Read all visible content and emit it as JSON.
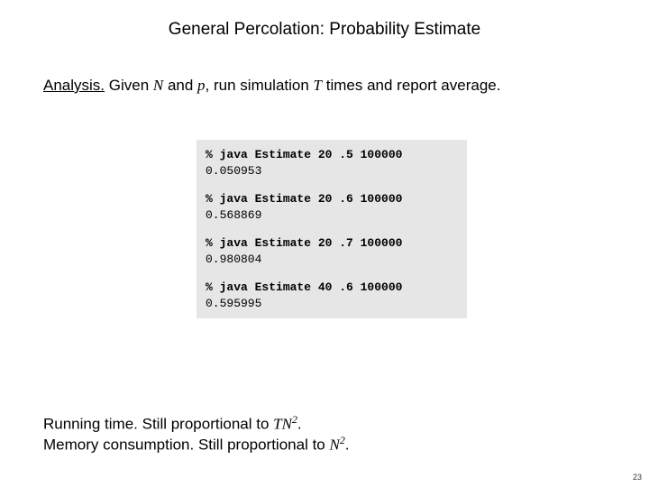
{
  "title": "General Percolation: Probability Estimate",
  "analysis": {
    "label": "Analysis.",
    "text_before_N": " Given ",
    "N": "N",
    "text_and": " and ",
    "p": "p",
    "text_mid": ", run simulation ",
    "T": "T",
    "text_after": " times and report average."
  },
  "code": {
    "entries": [
      {
        "cmd": "% java Estimate 20 .5 100000",
        "out": "0.050953"
      },
      {
        "cmd": "% java Estimate 20 .6 100000",
        "out": "0.568869"
      },
      {
        "cmd": "% java Estimate 20 .7 100000",
        "out": "0.980804"
      },
      {
        "cmd": "% java Estimate 40 .6 100000",
        "out": "0.595995"
      }
    ]
  },
  "running": {
    "label": "Running time.",
    "text": " Still proportional to ",
    "TN": "TN",
    "exp": "2",
    "period": "."
  },
  "memory": {
    "label": "Memory consumption.",
    "text": " Still proportional to ",
    "N": "N",
    "exp": "2",
    "period": "."
  },
  "page_number": "23"
}
